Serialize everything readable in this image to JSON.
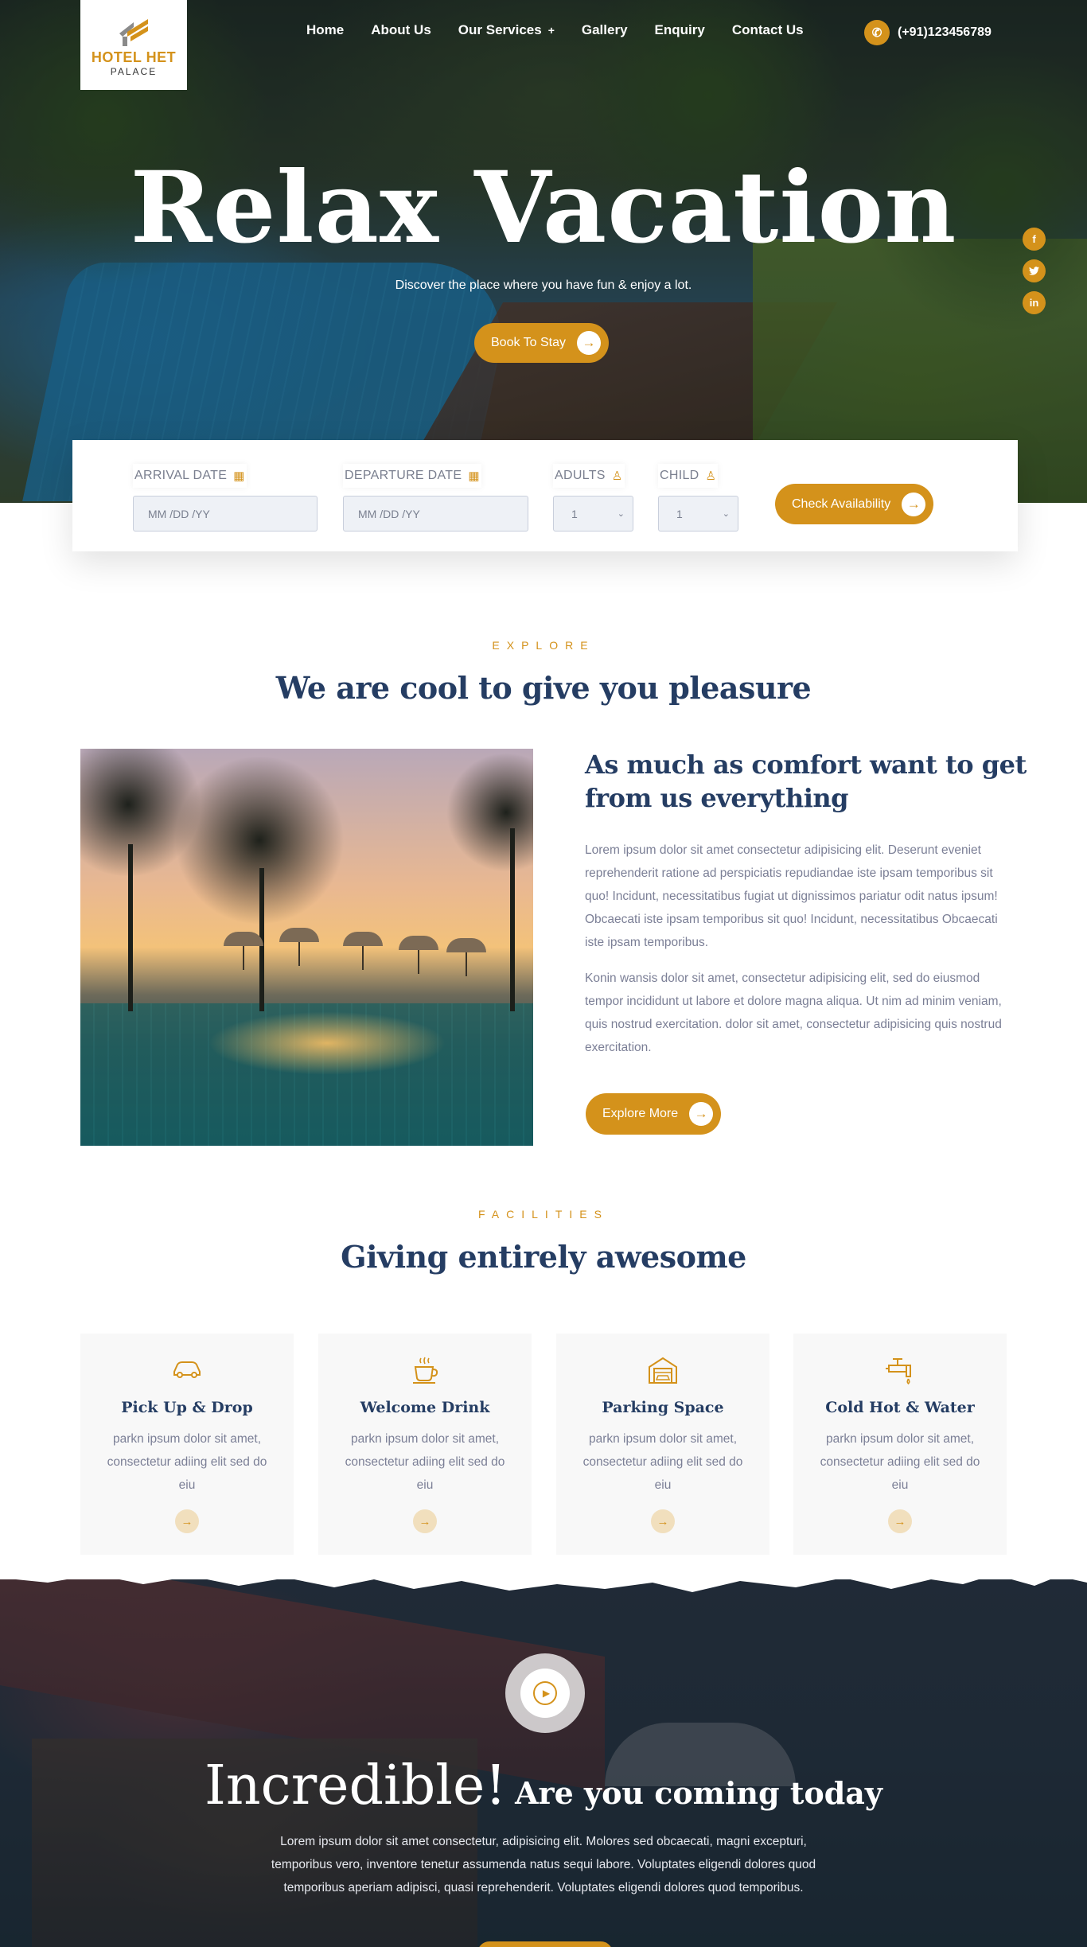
{
  "brand": {
    "name": "HOTEL HET",
    "sub": "PALACE",
    "accent": "#d4921b",
    "heading_color": "#253d63"
  },
  "nav": {
    "items": [
      "Home",
      "About Us",
      "Our Services",
      "Gallery",
      "Enquiry",
      "Contact Us"
    ],
    "services_plus": "+",
    "phone": "(+91)123456789",
    "phone_icon": "phone-icon"
  },
  "hero": {
    "title": "Relax Vacation",
    "subtitle": "Discover the place where you have fun & enjoy a lot.",
    "button": "Book To Stay",
    "socials": [
      "f",
      "t",
      "in"
    ]
  },
  "booking": {
    "arrival_label": "ARRIVAL DATE",
    "arrival_placeholder": "MM /DD /YY",
    "departure_label": "DEPARTURE DATE",
    "departure_placeholder": "MM /DD /YY",
    "adults_label": "ADULTS",
    "adults_value": "1",
    "child_label": "CHILD",
    "child_value": "1",
    "button": "Check Availability"
  },
  "explore": {
    "eyebrow": "EXPLORE",
    "title": "We are cool to give you pleasure",
    "heading": "As much as comfort want to get from us everything",
    "para1": "Lorem ipsum dolor sit amet consectetur adipisicing elit. Deserunt eveniet reprehenderit ratione ad perspiciatis repudiandae iste ipsam temporibus sit quo! Incidunt, necessitatibus fugiat ut dignissimos pariatur odit natus ipsum! Obcaecati iste ipsam temporibus sit quo! Incidunt, necessitatibus Obcaecati iste ipsam temporibus.",
    "para2": "Konin wansis dolor sit amet, consectetur adipisicing elit, sed do eiusmod tempor incididunt ut labore et dolore magna aliqua. Ut nim ad minim veniam, quis nostrud exercitation. dolor sit amet, consectetur adipisicing quis nostrud exercitation.",
    "button": "Explore More"
  },
  "facilities": {
    "eyebrow": "FACILITIES",
    "title": "Giving entirely awesome",
    "cards": [
      {
        "icon": "car-icon",
        "title": "Pick Up & Drop",
        "desc": "parkn ipsum dolor sit amet, consectetur adiing elit sed do eiu"
      },
      {
        "icon": "coffee-cup-icon",
        "title": "Welcome Drink",
        "desc": "parkn ipsum dolor sit amet, consectetur adiing elit sed do eiu"
      },
      {
        "icon": "garage-icon",
        "title": "Parking Space",
        "desc": "parkn ipsum dolor sit amet, consectetur adiing elit sed do eiu"
      },
      {
        "icon": "water-tap-icon",
        "title": "Cold Hot & Water",
        "desc": "parkn ipsum dolor sit amet, consectetur adiing elit sed do eiu"
      }
    ]
  },
  "video": {
    "title_big": "Incredible!",
    "title_small": "Are you coming today",
    "paragraph": "Lorem ipsum dolor sit amet consectetur, adipisicing elit. Molores sed obcaecati, magni excepturi, temporibus vero, inventore tenetur assumenda natus sequi labore. Voluptates eligendi dolores quod temporibus aperiam adipisci, quasi reprehenderit. Voluptates eligendi dolores quod temporibus."
  }
}
